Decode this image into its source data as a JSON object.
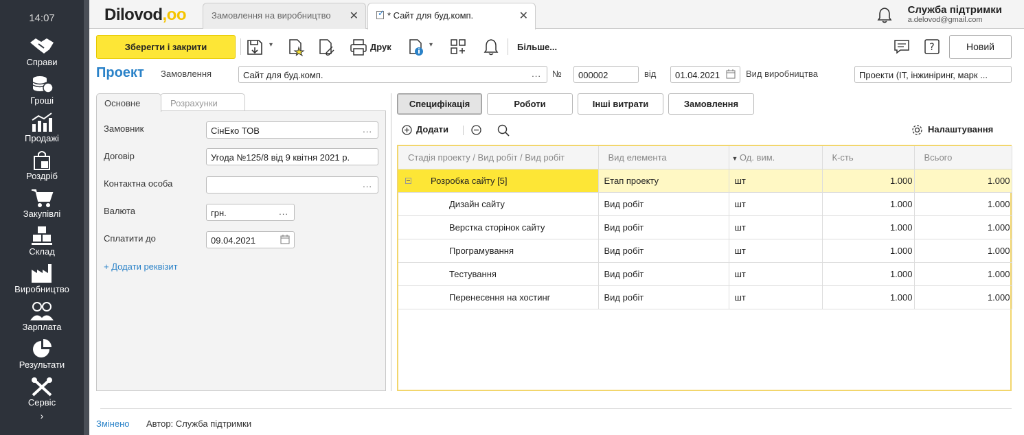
{
  "clock": "14:07",
  "sidebar": {
    "items": [
      {
        "label": "Справи",
        "icon": "handshake-icon"
      },
      {
        "label": "Гроші",
        "icon": "coins-icon"
      },
      {
        "label": "Продажі",
        "icon": "sales-chart-icon"
      },
      {
        "label": "Роздріб",
        "icon": "shopping-bag-icon"
      },
      {
        "label": "Закупівлі",
        "icon": "cart-icon"
      },
      {
        "label": "Склад",
        "icon": "boxes-icon"
      },
      {
        "label": "Виробництво",
        "icon": "factory-icon"
      },
      {
        "label": "Зарплата",
        "icon": "people-icon"
      },
      {
        "label": "Результати",
        "icon": "pie-chart-icon"
      },
      {
        "label": "Сервіс",
        "icon": "tools-icon"
      }
    ],
    "more": "›"
  },
  "header": {
    "logo_text": "Dilovod",
    "logo_dots": ",oo",
    "tabs": [
      {
        "label": "Замовлення на виробництво"
      },
      {
        "label": "* Сайт для буд.комп."
      }
    ],
    "support_name": "Служба підтримки",
    "support_email": "a.delovod@gmail.com"
  },
  "toolbar": {
    "save_close": "Зберегти і закрити",
    "print": "Друк",
    "more": "Більше...",
    "new": "Новий"
  },
  "doc": {
    "title": "Проект",
    "order_label": "Замовлення",
    "order_value": "Сайт для буд.комп.",
    "number_label": "№",
    "number_value": "000002",
    "date_label": "від",
    "date_value": "01.04.2021",
    "prod_type_label": "Вид виробництва",
    "prod_type_value": "Проекти (IT, інжиніринг, марк ..."
  },
  "left_panel": {
    "tabs": [
      "Основне",
      "Розрахунки"
    ],
    "fields": [
      {
        "label": "Замовник",
        "value": "СінЕко ТОВ"
      },
      {
        "label": "Договір",
        "value": "Угода №125/8 від 9 квітня 2021 р."
      },
      {
        "label": "Контактна особа",
        "value": ""
      },
      {
        "label": "Валюта",
        "value": "грн."
      },
      {
        "label": "Сплатити до",
        "value": "09.04.2021"
      }
    ],
    "add_requisite": "+ Додати реквізит"
  },
  "right_panel": {
    "tabs": [
      "Специфікація",
      "Роботи",
      "Інші витрати",
      "Замовлення"
    ],
    "add": "Додати",
    "settings": "Налаштування",
    "columns": [
      "Стадія проекту / Вид робіт / Вид робіт",
      "Вид елемента",
      "Од. вим.",
      "К-сть",
      "Всього"
    ],
    "rows": [
      {
        "name": "Розробка сайту [5]",
        "type": "Етап проекту",
        "unit": "шт",
        "qty": "1.000",
        "total": "1.000"
      },
      {
        "name": "Дизайн сайту",
        "type": "Вид робіт",
        "unit": "шт",
        "qty": "1.000",
        "total": "1.000"
      },
      {
        "name": "Верстка сторінок сайту",
        "type": "Вид робіт",
        "unit": "шт",
        "qty": "1.000",
        "total": "1.000"
      },
      {
        "name": "Програмування",
        "type": "Вид робіт",
        "unit": "шт",
        "qty": "1.000",
        "total": "1.000"
      },
      {
        "name": "Тестування",
        "type": "Вид робіт",
        "unit": "шт",
        "qty": "1.000",
        "total": "1.000"
      },
      {
        "name": "Перенесення на хостинг",
        "type": "Вид робіт",
        "unit": "шт",
        "qty": "1.000",
        "total": "1.000"
      }
    ]
  },
  "footer": {
    "changed": "Змінено",
    "author": "Автор: Служба підтримки"
  },
  "colors": {
    "accent_yellow": "#fde636",
    "link_blue": "#2a82c8",
    "sidebar_bg": "#2d323a"
  }
}
